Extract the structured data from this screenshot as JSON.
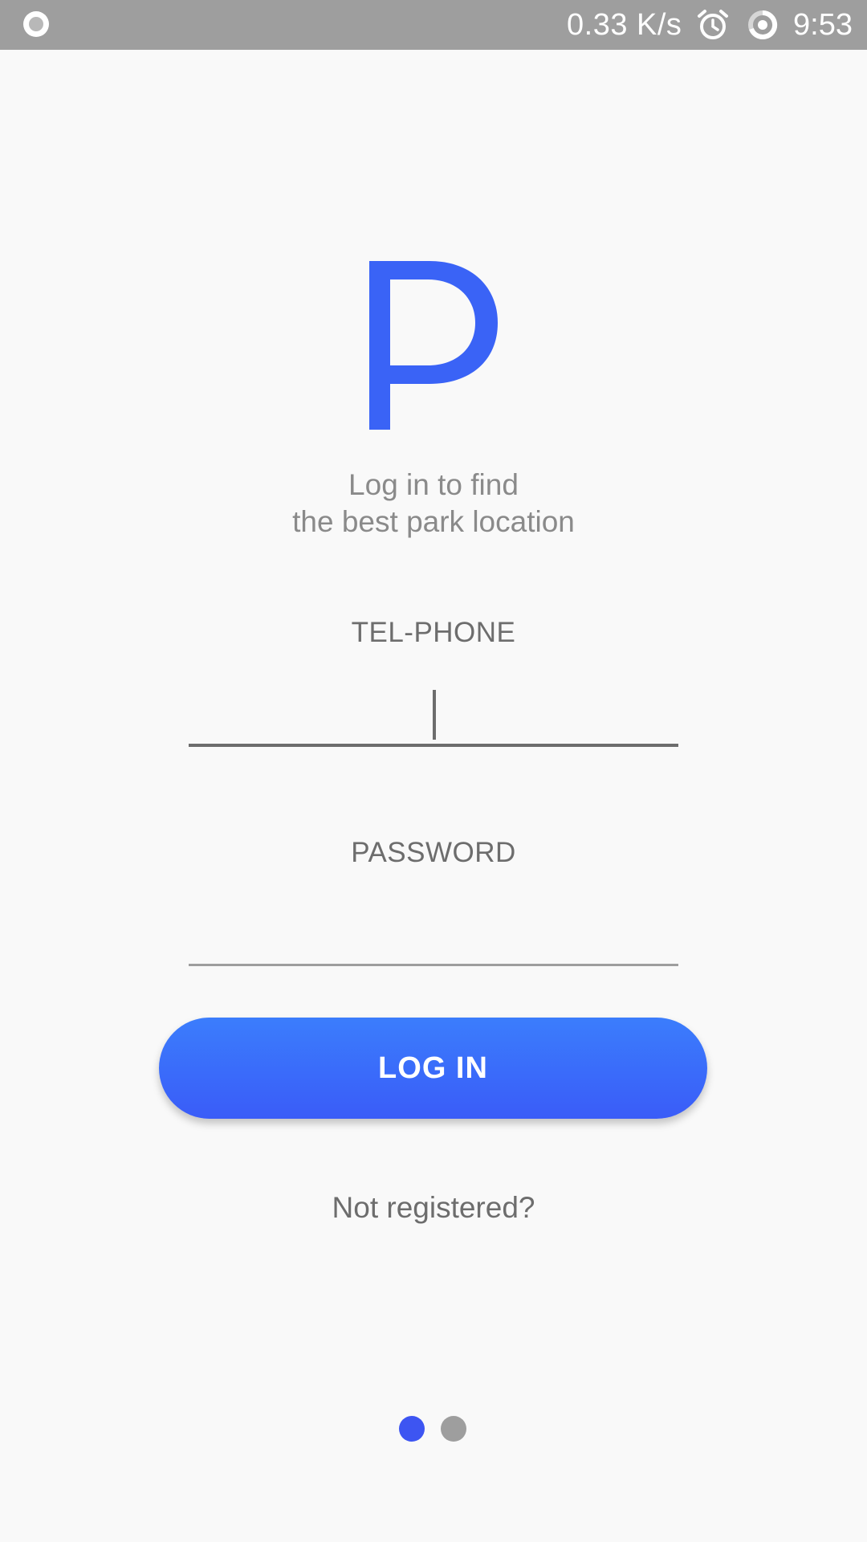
{
  "status_bar": {
    "network_speed": "0.33 K/s",
    "time": "9:53",
    "icons": [
      "record-icon",
      "alarm-icon",
      "sync-icon"
    ],
    "background_color": "#9e9e9e"
  },
  "logo": {
    "letter": "P",
    "color": "#3a63f6"
  },
  "tagline": {
    "line1": "Log in to find",
    "line2": "the best park location"
  },
  "form": {
    "phone_label": "TEL-PHONE",
    "phone_value": "",
    "password_label": "PASSWORD",
    "password_value": ""
  },
  "login_button": {
    "label": "LOG IN",
    "color": "#3a5cf8"
  },
  "register_link": {
    "label": "Not registered?"
  },
  "page_indicator": {
    "total": 2,
    "active": 1,
    "active_color": "#3d55f2",
    "inactive_color": "#9e9e9e"
  }
}
